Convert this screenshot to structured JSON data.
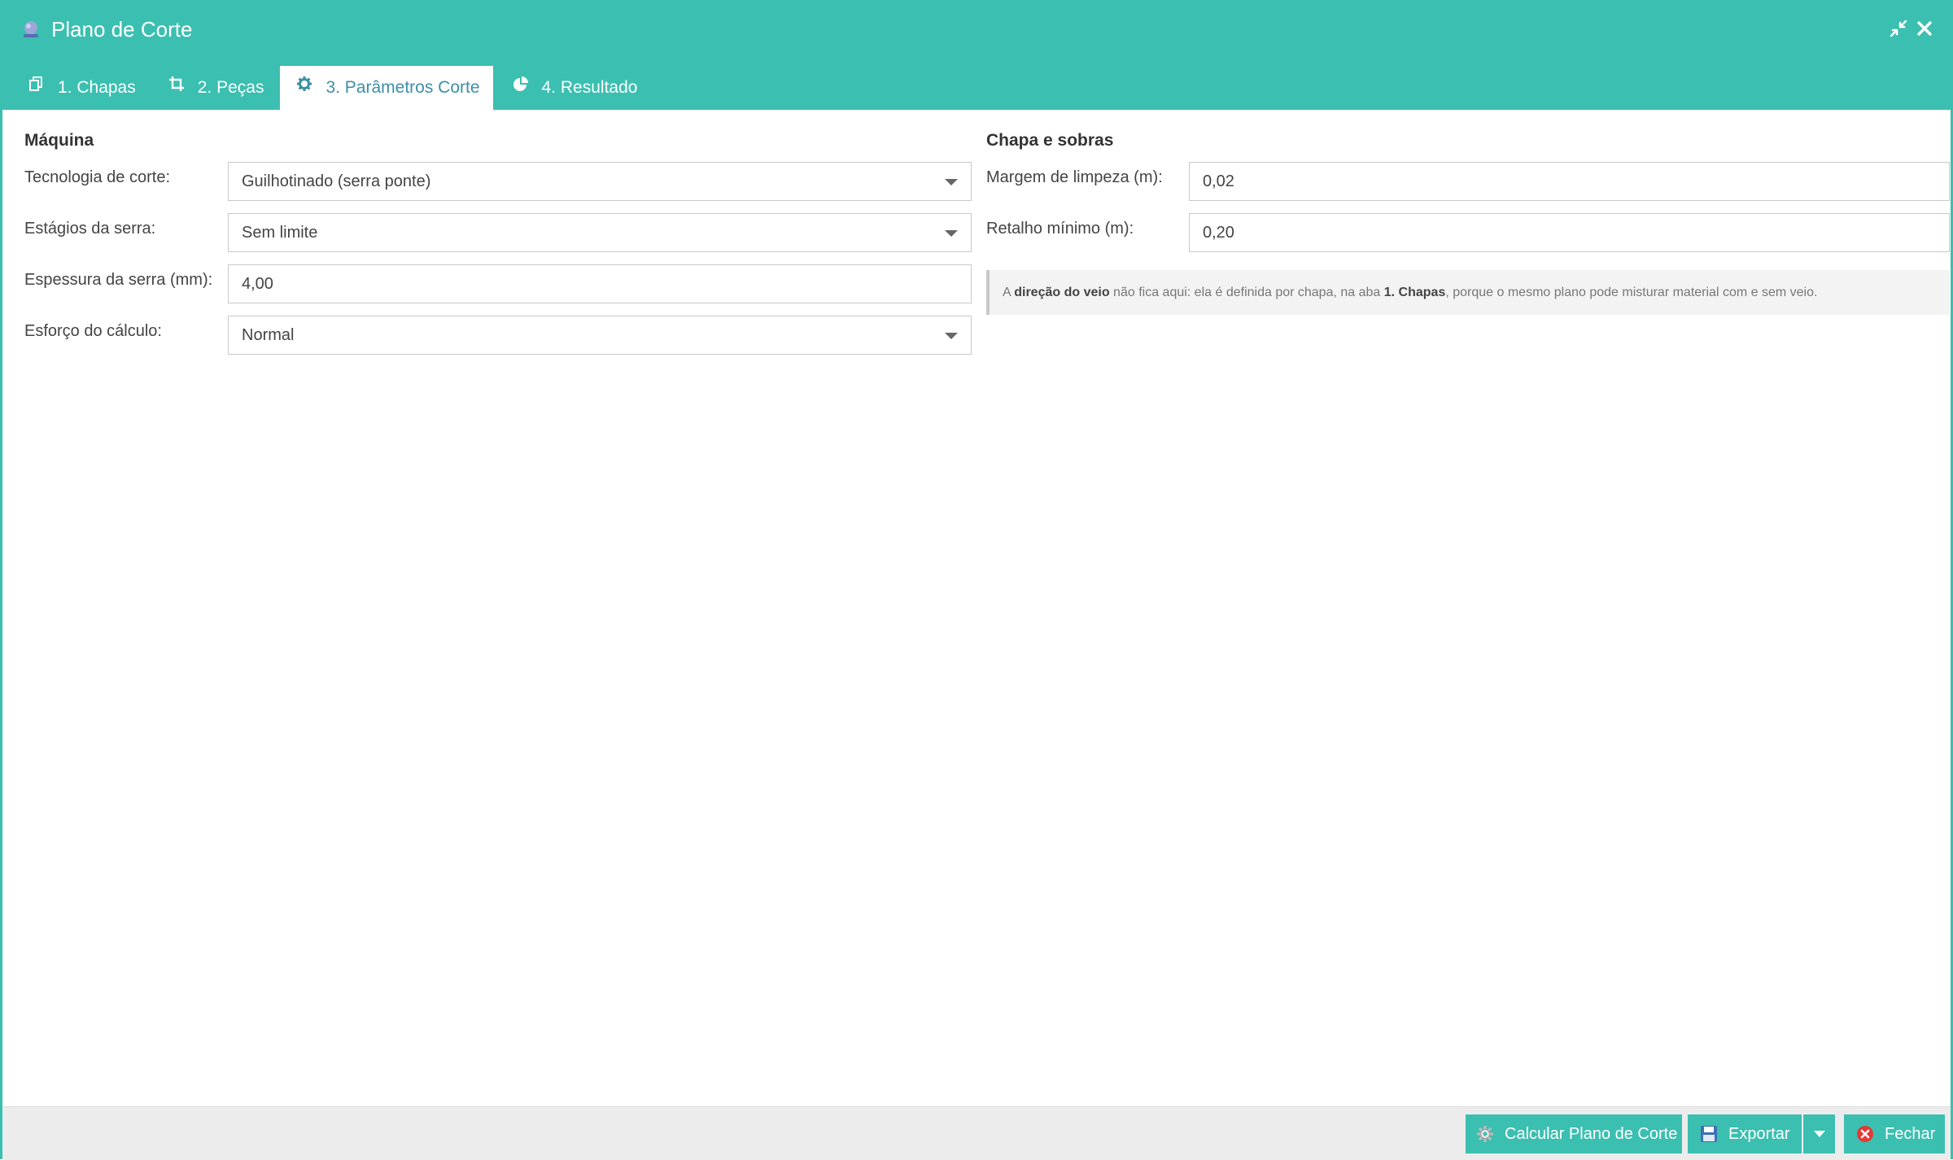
{
  "window": {
    "title": "Plano de Corte",
    "icons": {
      "app": "app-logo-icon",
      "restore": "compress-icon",
      "close": "close-icon"
    }
  },
  "tabs": [
    {
      "label": "1. Chapas",
      "icon": "sheets-icon",
      "active": false
    },
    {
      "label": "2. Peças",
      "icon": "crop-icon",
      "active": false
    },
    {
      "label": "3. Parâmetros Corte",
      "icon": "gear-icon",
      "active": true
    },
    {
      "label": "4. Resultado",
      "icon": "pie-chart-icon",
      "active": false
    }
  ],
  "machine": {
    "title": "Máquina",
    "cut_technology": {
      "label": "Tecnologia de corte:",
      "value": "Guilhotinado (serra ponte)"
    },
    "saw_stages": {
      "label": "Estágios da serra:",
      "value": "Sem limite"
    },
    "saw_thickness": {
      "label": "Espessura da serra (mm):",
      "value": "4,00"
    },
    "calc_effort": {
      "label": "Esforço do cálculo:",
      "value": "Normal"
    }
  },
  "sheet": {
    "title": "Chapa e sobras",
    "cleaning_margin": {
      "label": "Margem de limpeza (m):",
      "value": "0,02"
    },
    "min_remnant": {
      "label": "Retalho mínimo (m):",
      "value": "0,20"
    },
    "info": {
      "p1": "A ",
      "b1": "direção do veio",
      "p2": " não fica aqui: ela é definida por chapa, na aba ",
      "b2": "1. Chapas",
      "p3": ", porque o mesmo plano pode misturar material com e sem veio."
    }
  },
  "footer": {
    "calculate": "Calcular Plano de Corte",
    "export": "Exportar",
    "close": "Fechar"
  },
  "colors": {
    "accent": "#3bbfb0",
    "active_tab_text": "#3d8fa6",
    "close_icon_red": "#e53935"
  }
}
